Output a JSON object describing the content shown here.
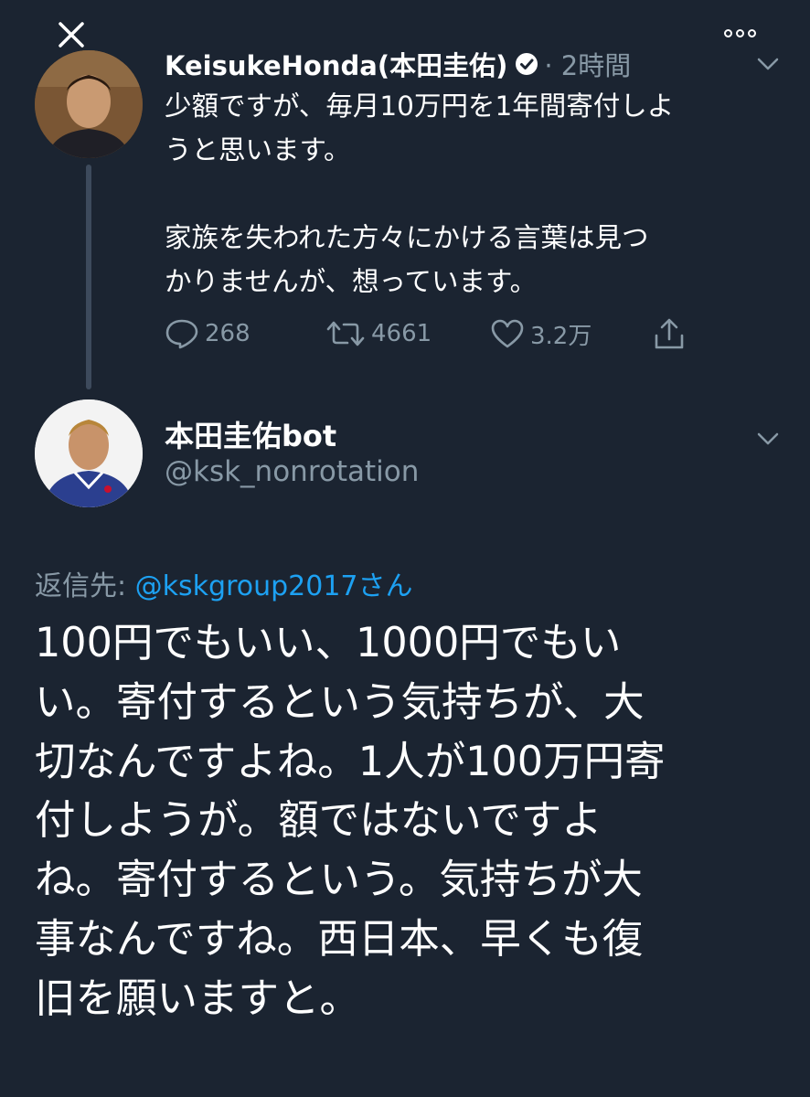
{
  "tweet1": {
    "display_name": "KeisukeHonda(本田圭佑)",
    "time": "· 2時間",
    "body": "少額ですが、毎月10万円を1年間寄付しよ\nうと思います。\n\n家族を失われた方々にかける言葉は見つ\nかりませんが、想っています。",
    "replies": "268",
    "retweets": "4661",
    "likes": "3.2万"
  },
  "tweet2": {
    "display_name": "本田圭佑bot",
    "handle": "@ksk_nonrotation",
    "reply_prefix": "返信先: ",
    "reply_mention": "@kskgroup2017さん",
    "body": "100円でもいい、1000円でもい\nい。寄付するという気持ちが、大\n切なんですよね。1人が100万円寄\n付しようが。額ではないですよ\nね。寄付するという。気持ちが大\n事なんですね。西日本、早くも復\n旧を願いますと。"
  },
  "colors": {
    "background": "#1b2431",
    "secondary_text": "#8899a6",
    "link": "#1da1f2"
  },
  "icons": [
    "close-icon",
    "more-icon",
    "verified-icon",
    "chevron-down-icon",
    "reply-icon",
    "retweet-icon",
    "like-icon",
    "share-icon"
  ]
}
